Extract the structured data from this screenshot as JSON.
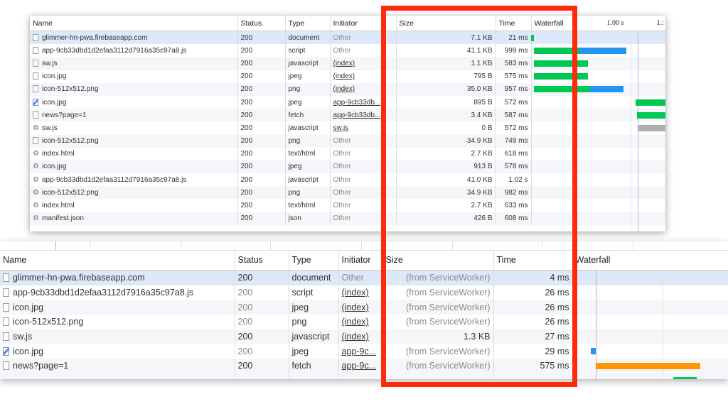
{
  "top": {
    "columns": [
      "Name",
      "Status",
      "Type",
      "Initiator",
      "Size",
      "Time",
      "Waterfall"
    ],
    "timeline_labels": [
      "1.00 s",
      "1.:"
    ],
    "rows": [
      {
        "icon": "file",
        "name": "glimmer-hn-pwa.firebaseapp.com",
        "status": "200",
        "type": "document",
        "initiator": "Other",
        "initiator_link": false,
        "size": "7.1 KB",
        "time": "21 ms"
      },
      {
        "icon": "file",
        "name": "app-9cb33dbd1d2efaa3112d7916a35c97a8.js",
        "status": "200",
        "type": "script",
        "initiator": "Other",
        "initiator_link": false,
        "size": "41.1 KB",
        "time": "999 ms"
      },
      {
        "icon": "file",
        "name": "sw.js",
        "status": "200",
        "type": "javascript",
        "initiator": "(index)",
        "initiator_link": true,
        "size": "1.1 KB",
        "time": "583 ms"
      },
      {
        "icon": "file",
        "name": "icon.jpg",
        "status": "200",
        "type": "jpeg",
        "initiator": "(index)",
        "initiator_link": true,
        "size": "795 B",
        "time": "575 ms"
      },
      {
        "icon": "file",
        "name": "icon-512x512.png",
        "status": "200",
        "type": "png",
        "initiator": "(index)",
        "initiator_link": true,
        "size": "35.0 KB",
        "time": "957 ms"
      },
      {
        "icon": "image",
        "name": "icon.jpg",
        "status": "200",
        "type": "jpeg",
        "initiator": "app-9cb33db...",
        "initiator_link": true,
        "size": "895 B",
        "time": "572 ms"
      },
      {
        "icon": "file",
        "name": "news?page=1",
        "status": "200",
        "type": "fetch",
        "initiator": "app-9cb33db...",
        "initiator_link": true,
        "size": "3.4 KB",
        "time": "587 ms"
      },
      {
        "icon": "gear",
        "name": "sw.js",
        "status": "200",
        "type": "javascript",
        "initiator": "sw.js",
        "initiator_link": true,
        "size": "0 B",
        "time": "572 ms"
      },
      {
        "icon": "file",
        "name": "icon-512x512.png",
        "status": "200",
        "type": "png",
        "initiator": "Other",
        "initiator_link": false,
        "size": "34.9 KB",
        "time": "749 ms"
      },
      {
        "icon": "gear",
        "name": "index.html",
        "status": "200",
        "type": "text/html",
        "initiator": "Other",
        "initiator_link": false,
        "size": "2.7 KB",
        "time": "618 ms"
      },
      {
        "icon": "gear",
        "name": "icon.jpg",
        "status": "200",
        "type": "jpeg",
        "initiator": "Other",
        "initiator_link": false,
        "size": "913 B",
        "time": "578 ms"
      },
      {
        "icon": "gear",
        "name": "app-9cb33dbd1d2efaa3112d7916a35c97a8.js",
        "status": "200",
        "type": "javascript",
        "initiator": "Other",
        "initiator_link": false,
        "size": "41.0 KB",
        "time": "1.02 s"
      },
      {
        "icon": "gear",
        "name": "icon-512x512.png",
        "status": "200",
        "type": "png",
        "initiator": "Other",
        "initiator_link": false,
        "size": "34.9 KB",
        "time": "982 ms"
      },
      {
        "icon": "gear",
        "name": "index.html",
        "status": "200",
        "type": "text/html",
        "initiator": "Other",
        "initiator_link": false,
        "size": "2.7 KB",
        "time": "633 ms"
      },
      {
        "icon": "gear",
        "name": "manifest.json",
        "status": "200",
        "type": "json",
        "initiator": "Other",
        "initiator_link": false,
        "size": "426 B",
        "time": "608 ms"
      }
    ],
    "waterfall": [
      {
        "row": 0,
        "segments": [
          {
            "start": 0.0,
            "end": 0.02,
            "color": "#00c853"
          }
        ]
      },
      {
        "row": 1,
        "segments": [
          {
            "start": 0.02,
            "end": 0.36,
            "color": "#00c853"
          },
          {
            "start": 0.36,
            "end": 0.71,
            "color": "#2196f3"
          }
        ]
      },
      {
        "row": 2,
        "segments": [
          {
            "start": 0.02,
            "end": 0.42,
            "color": "#00c853"
          }
        ]
      },
      {
        "row": 3,
        "segments": [
          {
            "start": 0.02,
            "end": 0.42,
            "color": "#00c853"
          }
        ]
      },
      {
        "row": 4,
        "segments": [
          {
            "start": 0.02,
            "end": 0.44,
            "color": "#00c853"
          },
          {
            "start": 0.44,
            "end": 0.69,
            "color": "#2196f3"
          }
        ]
      },
      {
        "row": 5,
        "segments": [
          {
            "start": 0.78,
            "end": 1.0,
            "color": "#00c853"
          }
        ]
      },
      {
        "row": 6,
        "segments": [
          {
            "start": 0.79,
            "end": 1.0,
            "color": "#00c853"
          }
        ]
      },
      {
        "row": 7,
        "segments": [
          {
            "start": 0.8,
            "end": 1.0,
            "color": "#b0b0b0"
          }
        ]
      }
    ]
  },
  "bottom": {
    "columns": [
      "Name",
      "Status",
      "Type",
      "Initiator",
      "Size",
      "Time",
      "Waterfall"
    ],
    "rows": [
      {
        "icon": "file",
        "name": "glimmer-hn-pwa.firebaseapp.com",
        "status": "200",
        "status_muted": false,
        "type": "document",
        "initiator": "Other",
        "initiator_link": false,
        "size": "(from ServiceWorker)",
        "time": "4 ms"
      },
      {
        "icon": "file",
        "name": "app-9cb33dbd1d2efaa3112d7916a35c97a8.js",
        "status": "200",
        "status_muted": true,
        "type": "script",
        "initiator": "(index)",
        "initiator_link": true,
        "size": "(from ServiceWorker)",
        "time": "26 ms"
      },
      {
        "icon": "file",
        "name": "icon.jpg",
        "status": "200",
        "status_muted": true,
        "type": "jpeg",
        "initiator": "(index)",
        "initiator_link": true,
        "size": "(from ServiceWorker)",
        "time": "26 ms"
      },
      {
        "icon": "file",
        "name": "icon-512x512.png",
        "status": "200",
        "status_muted": true,
        "type": "png",
        "initiator": "(index)",
        "initiator_link": true,
        "size": "(from ServiceWorker)",
        "time": "26 ms"
      },
      {
        "icon": "file",
        "name": "sw.js",
        "status": "200",
        "status_muted": false,
        "type": "javascript",
        "initiator": "(index)",
        "initiator_link": true,
        "size": "1.3 KB",
        "time": "27 ms"
      },
      {
        "icon": "image",
        "name": "icon.jpg",
        "status": "200",
        "status_muted": true,
        "type": "jpeg",
        "initiator": "app-9c...",
        "initiator_link": true,
        "size": "(from ServiceWorker)",
        "time": "29 ms"
      },
      {
        "icon": "file",
        "name": "news?page=1",
        "status": "200",
        "status_muted": false,
        "type": "fetch",
        "initiator": "app-9c...",
        "initiator_link": true,
        "size": "(from ServiceWorker)",
        "time": "575 ms"
      }
    ],
    "waterfall": [
      {
        "row": 0,
        "segments": [
          {
            "start": 0.0,
            "end": 0.015,
            "color": "#2196f3"
          }
        ]
      },
      {
        "row": 5,
        "segments": [
          {
            "start": 0.12,
            "end": 0.15,
            "color": "#2196f3"
          }
        ]
      },
      {
        "row": 6,
        "segments": [
          {
            "start": 0.15,
            "end": 0.82,
            "color": "#ff9800"
          }
        ]
      },
      {
        "row": 7,
        "segments": [
          {
            "start": 0.65,
            "end": 0.8,
            "color": "#00c853"
          }
        ]
      }
    ]
  },
  "colors": {
    "highlight": "#ff2a0a",
    "selected_row": "#dde8f8",
    "alt_row": "#f4f6f9"
  }
}
